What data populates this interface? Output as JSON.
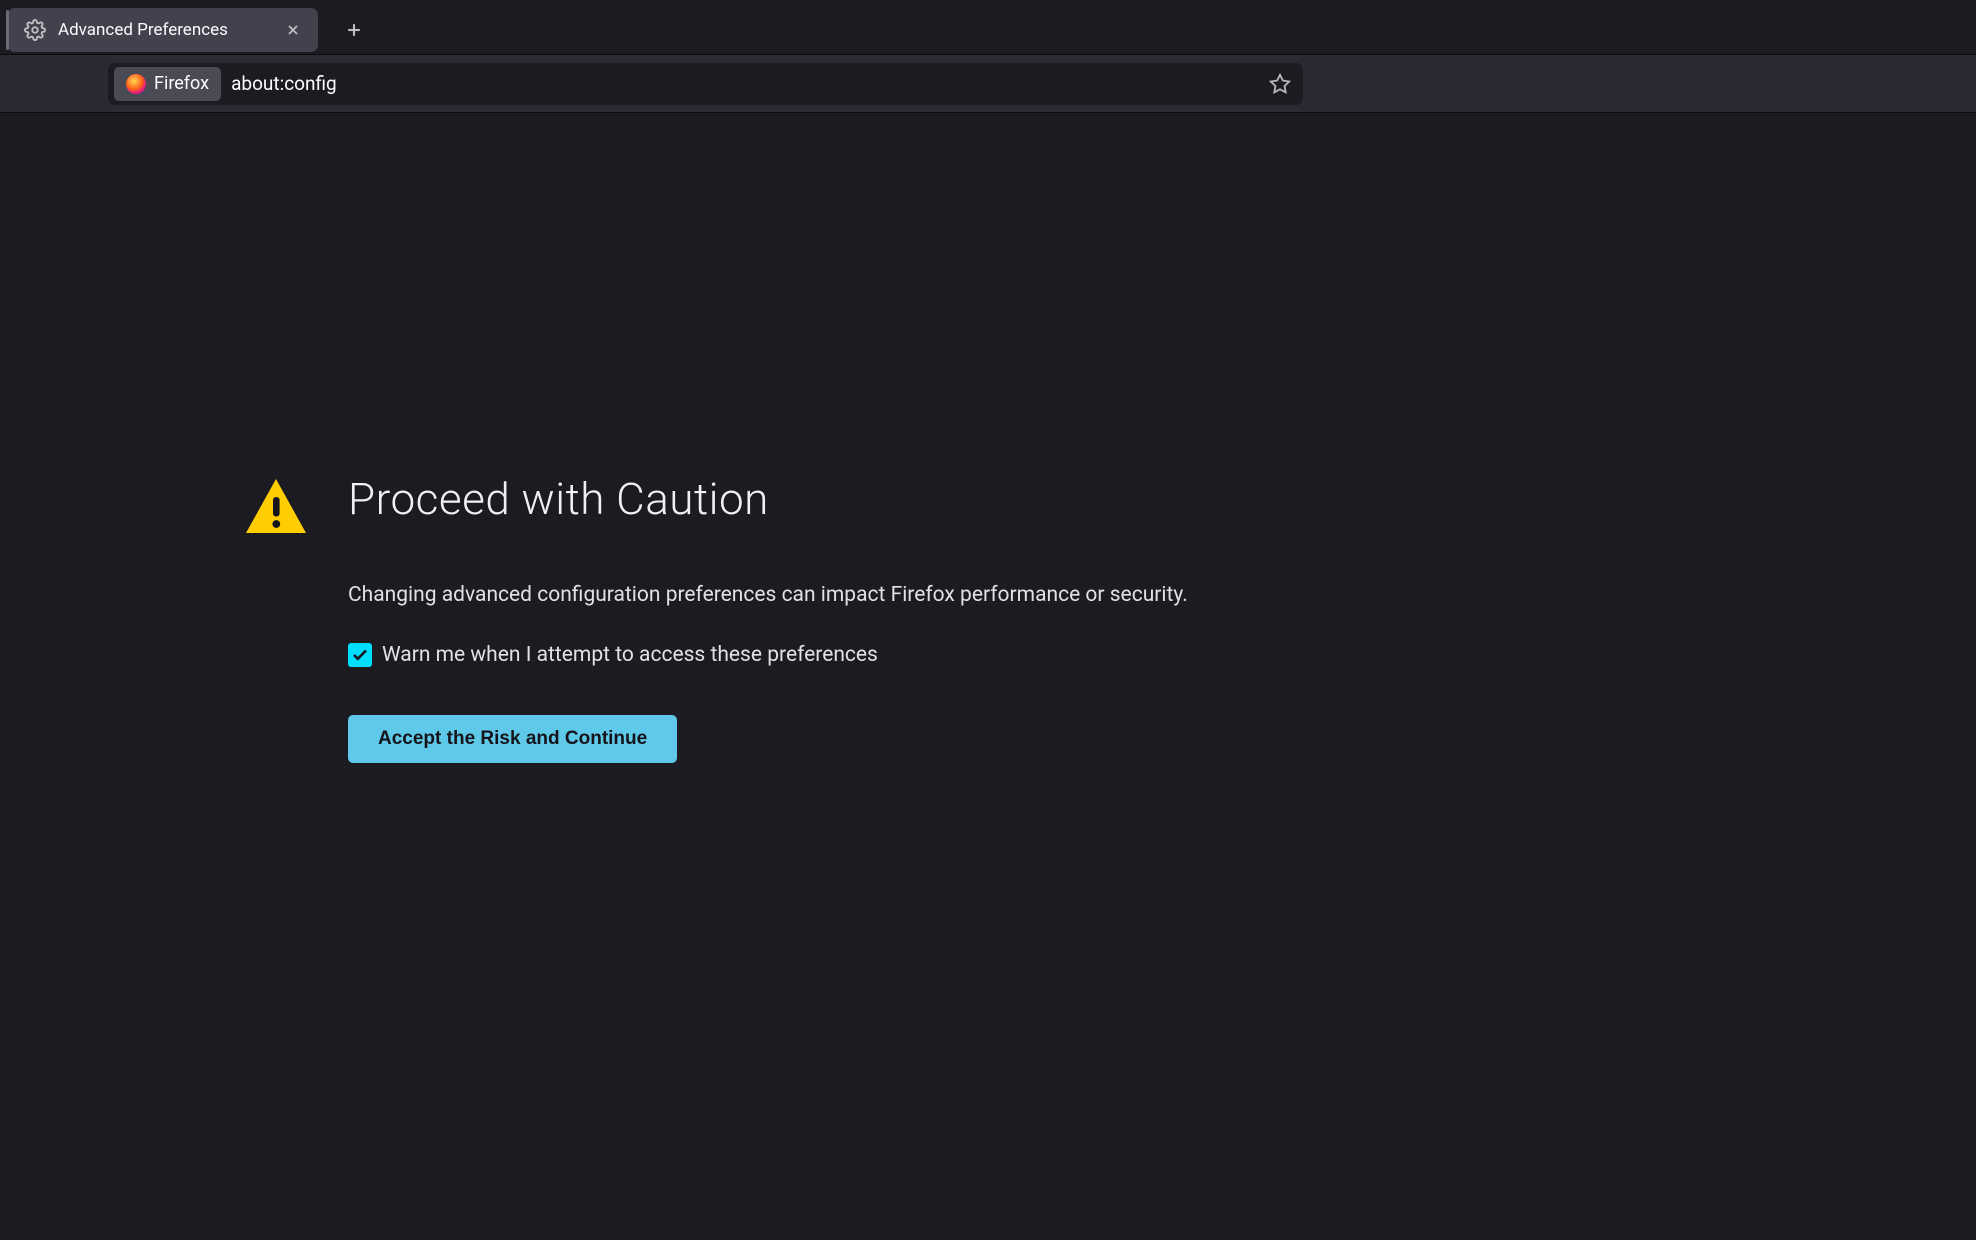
{
  "tab": {
    "title": "Advanced Preferences"
  },
  "urlbar": {
    "identity_label": "Firefox",
    "url": "about:config"
  },
  "warning": {
    "title": "Proceed with Caution",
    "description": "Changing advanced configuration preferences can impact Firefox performance or security.",
    "checkbox_label": "Warn me when I attempt to access these preferences",
    "checkbox_checked": true,
    "accept_button": "Accept the Risk and Continue"
  }
}
